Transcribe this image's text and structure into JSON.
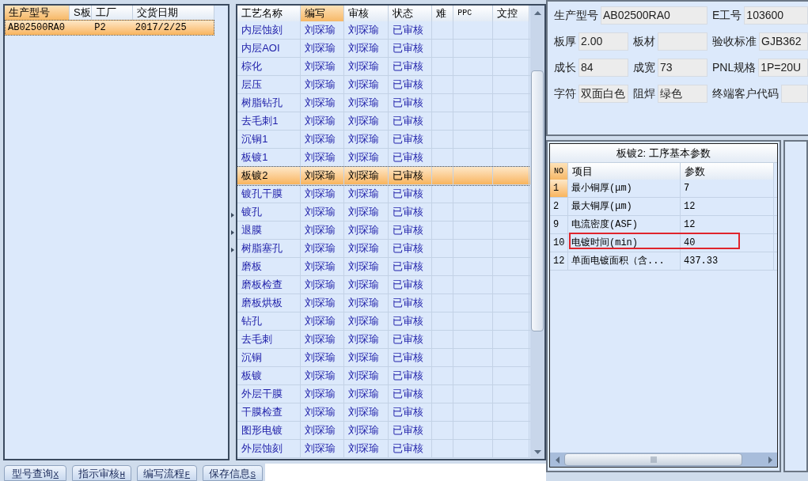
{
  "order_list": {
    "columns": [
      {
        "label": "生产型号",
        "selected": true
      },
      {
        "label": "S板",
        "selected": false
      },
      {
        "label": "工厂",
        "selected": false
      },
      {
        "label": "交货日期",
        "selected": false
      }
    ],
    "rows": [
      {
        "selected": true,
        "cells": [
          "AB02500RA0",
          "",
          "P2",
          "2017/2/25"
        ]
      }
    ]
  },
  "process_grid": {
    "columns": [
      {
        "label": "工艺名称",
        "selected": false
      },
      {
        "label": "编写",
        "selected": true
      },
      {
        "label": "审核",
        "selected": false
      },
      {
        "label": "状态",
        "selected": false
      },
      {
        "label": "难",
        "selected": false
      },
      {
        "label": "PPC",
        "selected": false
      },
      {
        "label": "文控",
        "selected": false
      }
    ],
    "rows": [
      {
        "selected": false,
        "cells": [
          "内层蚀刻",
          "刘琛瑜",
          "刘琛瑜",
          "已审核"
        ]
      },
      {
        "selected": false,
        "cells": [
          "内层AOI",
          "刘琛瑜",
          "刘琛瑜",
          "已审核"
        ]
      },
      {
        "selected": false,
        "cells": [
          "棕化",
          "刘琛瑜",
          "刘琛瑜",
          "已审核"
        ]
      },
      {
        "selected": false,
        "cells": [
          "层压",
          "刘琛瑜",
          "刘琛瑜",
          "已审核"
        ]
      },
      {
        "selected": false,
        "cells": [
          "树脂钻孔",
          "刘琛瑜",
          "刘琛瑜",
          "已审核"
        ]
      },
      {
        "selected": false,
        "cells": [
          "去毛刺1",
          "刘琛瑜",
          "刘琛瑜",
          "已审核"
        ]
      },
      {
        "selected": false,
        "cells": [
          "沉铜1",
          "刘琛瑜",
          "刘琛瑜",
          "已审核"
        ]
      },
      {
        "selected": false,
        "cells": [
          "板镀1",
          "刘琛瑜",
          "刘琛瑜",
          "已审核"
        ]
      },
      {
        "selected": true,
        "cells": [
          "板镀2",
          "刘琛瑜",
          "刘琛瑜",
          "已审核"
        ]
      },
      {
        "selected": false,
        "cells": [
          "镀孔干膜",
          "刘琛瑜",
          "刘琛瑜",
          "已审核"
        ]
      },
      {
        "selected": false,
        "cells": [
          "镀孔",
          "刘琛瑜",
          "刘琛瑜",
          "已审核"
        ]
      },
      {
        "selected": false,
        "cells": [
          "退膜",
          "刘琛瑜",
          "刘琛瑜",
          "已审核"
        ]
      },
      {
        "selected": false,
        "cells": [
          "树脂塞孔",
          "刘琛瑜",
          "刘琛瑜",
          "已审核"
        ]
      },
      {
        "selected": false,
        "cells": [
          "磨板",
          "刘琛瑜",
          "刘琛瑜",
          "已审核"
        ]
      },
      {
        "selected": false,
        "cells": [
          "磨板检查",
          "刘琛瑜",
          "刘琛瑜",
          "已审核"
        ]
      },
      {
        "selected": false,
        "cells": [
          "磨板烘板",
          "刘琛瑜",
          "刘琛瑜",
          "已审核"
        ]
      },
      {
        "selected": false,
        "cells": [
          "钻孔",
          "刘琛瑜",
          "刘琛瑜",
          "已审核"
        ]
      },
      {
        "selected": false,
        "cells": [
          "去毛刺",
          "刘琛瑜",
          "刘琛瑜",
          "已审核"
        ]
      },
      {
        "selected": false,
        "cells": [
          "沉铜",
          "刘琛瑜",
          "刘琛瑜",
          "已审核"
        ]
      },
      {
        "selected": false,
        "cells": [
          "板镀",
          "刘琛瑜",
          "刘琛瑜",
          "已审核"
        ]
      },
      {
        "selected": false,
        "cells": [
          "外层干膜",
          "刘琛瑜",
          "刘琛瑜",
          "已审核"
        ]
      },
      {
        "selected": false,
        "cells": [
          "干膜检查",
          "刘琛瑜",
          "刘琛瑜",
          "已审核"
        ]
      },
      {
        "selected": false,
        "cells": [
          "图形电镀",
          "刘琛瑜",
          "刘琛瑜",
          "已审核"
        ]
      },
      {
        "selected": false,
        "cells": [
          "外层蚀刻",
          "刘琛瑜",
          "刘琛瑜",
          "已审核"
        ]
      }
    ]
  },
  "info_form": {
    "rows": [
      [
        {
          "label": "生产型号",
          "value": "AB02500RA0",
          "colspan": 2
        },
        {
          "label": "E工号",
          "value": "103600"
        }
      ],
      [
        {
          "label": "板厚",
          "value": "2.00"
        },
        {
          "label": "板材"
        },
        {
          "label": "验收标准",
          "value": "GJB362"
        }
      ],
      [
        {
          "label": "成长",
          "value": "84"
        },
        {
          "label": "成宽",
          "value": "73"
        },
        {
          "label": "PNL规格",
          "value": "1P=20U"
        }
      ],
      [
        {
          "label": "字符",
          "value": "双面白色"
        },
        {
          "label": "阻焊",
          "value": "绿色"
        },
        {
          "label": "终端客户代码"
        }
      ]
    ]
  },
  "params_grid": {
    "title": "板镀2: 工序基本参数",
    "columns": [
      "NO",
      "项目",
      "参数"
    ],
    "rows": [
      {
        "selected": true,
        "highlighted": false,
        "cells": [
          "1",
          "最小铜厚(μm)",
          "7"
        ]
      },
      {
        "selected": false,
        "highlighted": false,
        "cells": [
          "2",
          "最大铜厚(μm)",
          "12"
        ]
      },
      {
        "selected": false,
        "highlighted": false,
        "cells": [
          "9",
          "电流密度(ASF)",
          "12"
        ]
      },
      {
        "selected": false,
        "highlighted": true,
        "cells": [
          "10",
          "电镀时间(min)",
          "40"
        ]
      },
      {
        "selected": false,
        "highlighted": false,
        "cells": [
          "12",
          "单面电镀面积（含...",
          "437.33"
        ]
      }
    ]
  },
  "buttons": [
    {
      "label": "型号查询",
      "shortcut": "X"
    },
    {
      "label": "指示审核",
      "shortcut": "H"
    },
    {
      "label": "编写流程",
      "shortcut": "F"
    },
    {
      "label": "保存信息",
      "shortcut": "S"
    }
  ]
}
